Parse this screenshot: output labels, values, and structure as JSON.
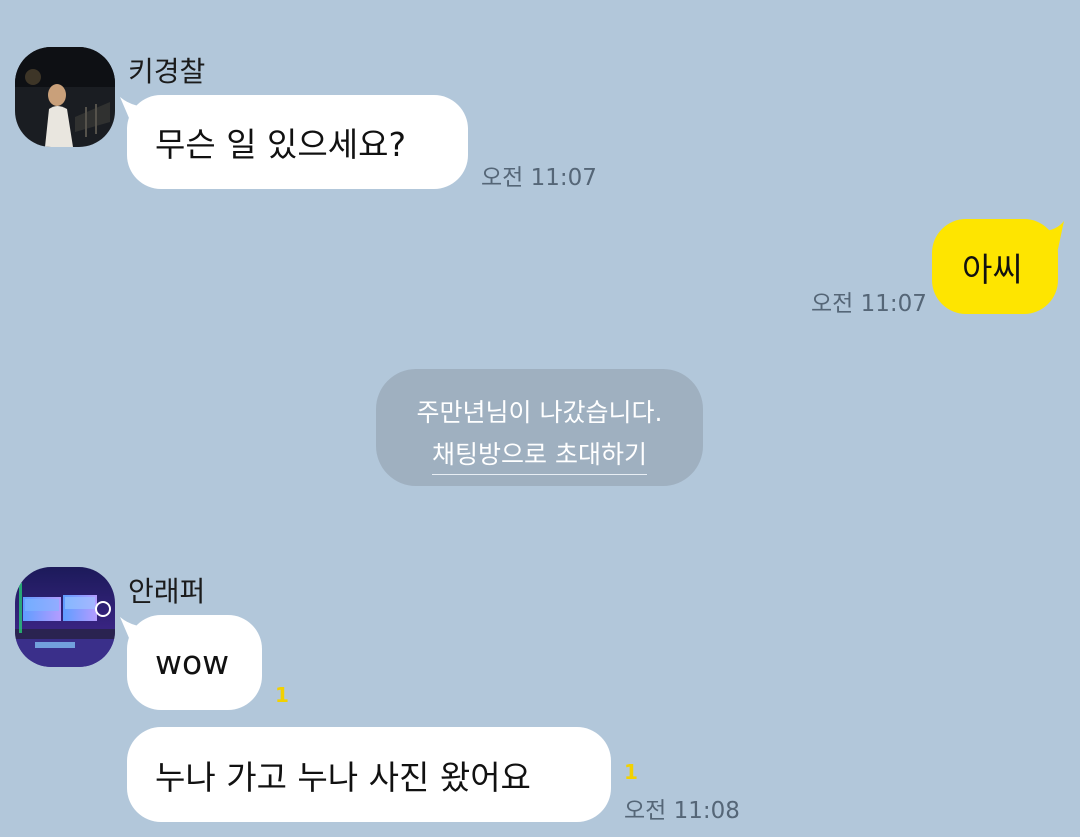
{
  "messages": [
    {
      "sender": "키경찰",
      "text": "무슨 일 있으세요?",
      "time": "오전 11:07",
      "direction": "incoming",
      "avatar": "night-portrait"
    },
    {
      "text": "아씨",
      "time": "오전 11:07",
      "direction": "outgoing"
    },
    {
      "sender": "안래퍼",
      "text": "wow",
      "unread": "1",
      "direction": "incoming",
      "avatar": "gaming-setup"
    },
    {
      "text": "누나 가고 누나 사진 왔어요",
      "unread": "1",
      "time": "오전 11:08",
      "direction": "incoming"
    }
  ],
  "notice": {
    "text": "주만년님이 나갔습니다.",
    "link": "채팅방으로 초대하기"
  },
  "colors": {
    "background": "#b2c7da",
    "incoming_bubble": "#ffffff",
    "outgoing_bubble": "#fee500",
    "unread": "#f2d100",
    "notice_bg": "#9fb0c0"
  }
}
